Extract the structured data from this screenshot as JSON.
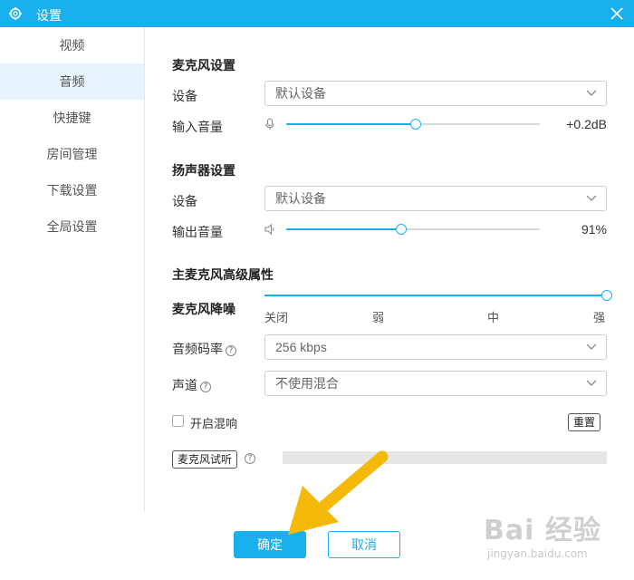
{
  "window": {
    "title": "设置",
    "accent": "#1ab0ee"
  },
  "sidebar": {
    "items": [
      {
        "label": "视频"
      },
      {
        "label": "音频"
      },
      {
        "label": "快捷键"
      },
      {
        "label": "房间管理"
      },
      {
        "label": "下载设置"
      },
      {
        "label": "全局设置"
      }
    ],
    "active_index": 1
  },
  "microphone": {
    "section_title": "麦克风设置",
    "device_label": "设备",
    "device_value": "默认设备",
    "volume_label": "输入音量",
    "volume_value": "+0.2dB",
    "volume_fraction": 0.51
  },
  "speaker": {
    "section_title": "扬声器设置",
    "device_label": "设备",
    "device_value": "默认设备",
    "volume_label": "输出音量",
    "volume_value": "91%",
    "volume_fraction": 0.455
  },
  "advanced": {
    "section_title": "主麦克风高级属性",
    "noise_label": "麦克风降噪",
    "noise_levels": [
      "关闭",
      "弱",
      "中",
      "强"
    ],
    "noise_selected": "强",
    "bitrate_label": "音频码率",
    "bitrate_value": "256 kbps",
    "channel_label": "声道",
    "channel_value": "不使用混合",
    "reverb_label": "开启混响",
    "reverb_checked": false,
    "reset_label": "重置",
    "mic_test_label": "麦克风试听",
    "help_glyph": "?"
  },
  "footer": {
    "ok_label": "确定",
    "cancel_label": "取消"
  },
  "watermark": {
    "text": "Bai 经验",
    "sub": "jingyan.baidu.com"
  },
  "icons": {
    "gear": "gear-icon",
    "close": "close-icon",
    "chevron": "chevron-down-icon",
    "mic": "microphone-icon",
    "speaker": "speaker-icon",
    "help": "help-icon"
  }
}
